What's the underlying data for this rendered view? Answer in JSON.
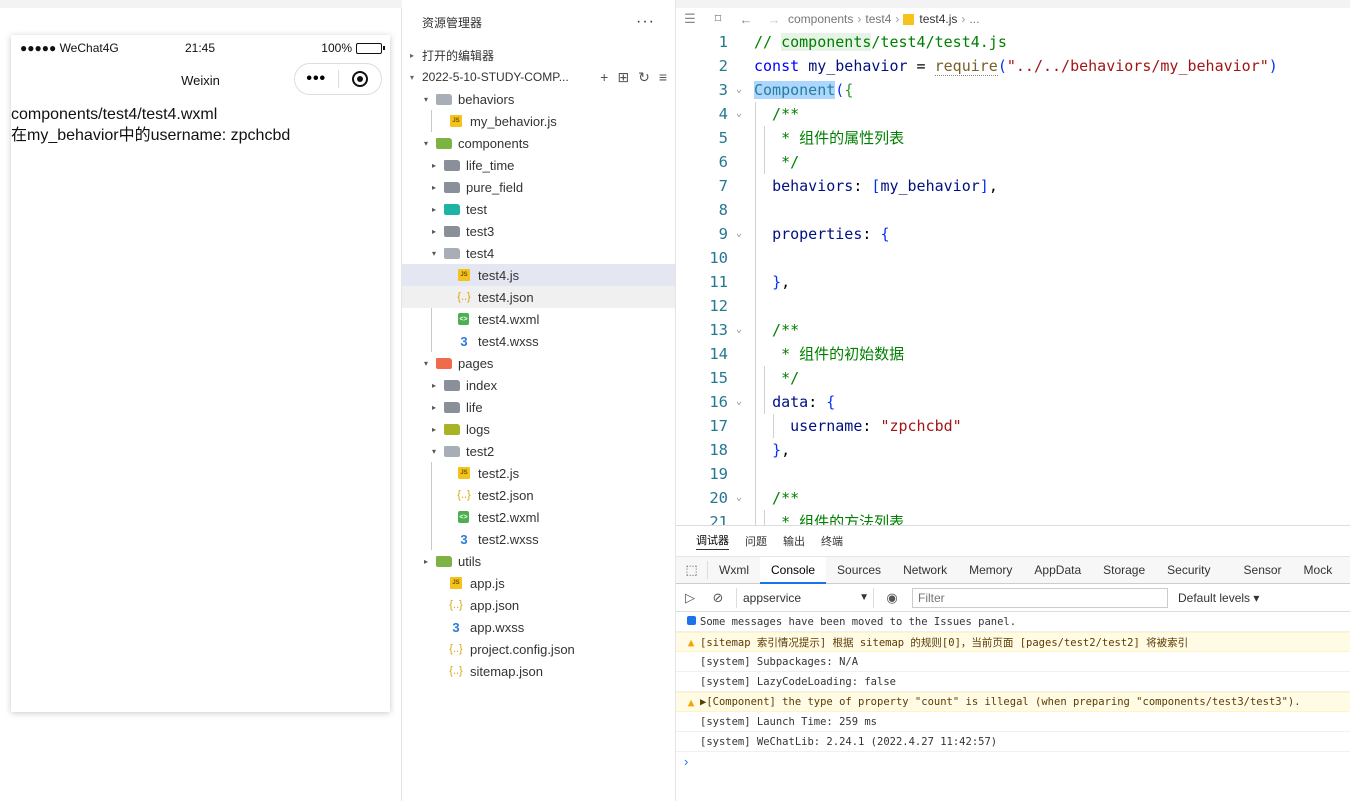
{
  "simulator": {
    "carrier": "●●●●● WeChat4G",
    "time": "21:45",
    "battery": "100%",
    "battery_level": 1.0,
    "nav_title": "Weixin",
    "capsule_more": "•••",
    "lines": [
      "components/test4/test4.wxml",
      "在my_behavior中的username: zpchcbd"
    ]
  },
  "explorer": {
    "title": "资源管理器",
    "more": "···",
    "open_editors": "打开的编辑器",
    "project": "2022-5-10-STUDY-COMP...",
    "project_actions": [
      "+",
      "⊞",
      "↻",
      "≡"
    ],
    "tree": [
      {
        "label": "behaviors",
        "icon": "folder-open-icon",
        "twisty": "▾"
      },
      {
        "label": "my_behavior.js",
        "icon": "js-file-icon"
      },
      {
        "label": "components",
        "icon": "folder-components-icon",
        "twisty": "▾"
      },
      {
        "label": "life_time",
        "icon": "folder-icon",
        "twisty": "▸"
      },
      {
        "label": "pure_field",
        "icon": "folder-icon",
        "twisty": "▸"
      },
      {
        "label": "test",
        "icon": "folder-test-icon",
        "twisty": "▸"
      },
      {
        "label": "test3",
        "icon": "folder-icon",
        "twisty": "▸"
      },
      {
        "label": "test4",
        "icon": "folder-open-icon",
        "twisty": "▾"
      },
      {
        "label": "test4.js",
        "icon": "js-file-icon"
      },
      {
        "label": "test4.json",
        "icon": "json-file-icon"
      },
      {
        "label": "test4.wxml",
        "icon": "wxml-file-icon"
      },
      {
        "label": "test4.wxss",
        "icon": "wxss-file-icon"
      },
      {
        "label": "pages",
        "icon": "folder-pages-icon",
        "twisty": "▾"
      },
      {
        "label": "index",
        "icon": "folder-icon",
        "twisty": "▸"
      },
      {
        "label": "life",
        "icon": "folder-icon",
        "twisty": "▸"
      },
      {
        "label": "logs",
        "icon": "folder-logs-icon",
        "twisty": "▸"
      },
      {
        "label": "test2",
        "icon": "folder-open-icon",
        "twisty": "▾"
      },
      {
        "label": "test2.js",
        "icon": "js-file-icon"
      },
      {
        "label": "test2.json",
        "icon": "json-file-icon"
      },
      {
        "label": "test2.wxml",
        "icon": "wxml-file-icon"
      },
      {
        "label": "test2.wxss",
        "icon": "wxss-file-icon"
      },
      {
        "label": "utils",
        "icon": "folder-utils-icon",
        "twisty": "▸"
      },
      {
        "label": "app.js",
        "icon": "js-file-icon"
      },
      {
        "label": "app.json",
        "icon": "json-file-icon"
      },
      {
        "label": "app.wxss",
        "icon": "wxss-file-icon"
      },
      {
        "label": "project.config.json",
        "icon": "json-file-icon"
      },
      {
        "label": "sitemap.json",
        "icon": "json-file-icon"
      }
    ]
  },
  "editor": {
    "breadcrumbs": [
      "components",
      "test4",
      "test4.js",
      "..."
    ],
    "lines": [
      "// components/test4/test4.js",
      "const my_behavior = require(\"../../behaviors/my_behavior\")",
      "Component({",
      "  /**",
      "   * 组件的属性列表",
      "   */",
      "  behaviors: [my_behavior],",
      "",
      "  properties: {",
      "",
      "  },",
      "",
      "  /**",
      "   * 组件的初始数据",
      "   */",
      "  data: {",
      "    username: \"zpchcbd\"",
      "  },",
      "",
      "  /**",
      "   * 组件的方法列表"
    ]
  },
  "devtools": {
    "tabs": [
      "调试器",
      "问题",
      "输出",
      "终端"
    ],
    "panels": [
      "Wxml",
      "Console",
      "Sources",
      "Network",
      "Memory",
      "AppData",
      "Storage",
      "Security",
      "Sensor",
      "Mock"
    ],
    "context": "appservice",
    "filter_placeholder": "Filter",
    "levels": "Default levels ▾",
    "messages": [
      "Some messages have been moved to the Issues panel.",
      "[sitemap 索引情况提示] 根据 sitemap 的规则[0]，当前页面 [pages/test2/test2] 将被索引",
      "[system] Subpackages: N/A",
      "[system] LazyCodeLoading: false",
      "▶[Component] the type of property \"count\" is illegal (when preparing \"components/test3/test3\").",
      "[system] Launch Time: 259 ms",
      "[system] WeChatLib: 2.24.1 (2022.4.27 11:42:57)"
    ],
    "prompt": "›"
  }
}
